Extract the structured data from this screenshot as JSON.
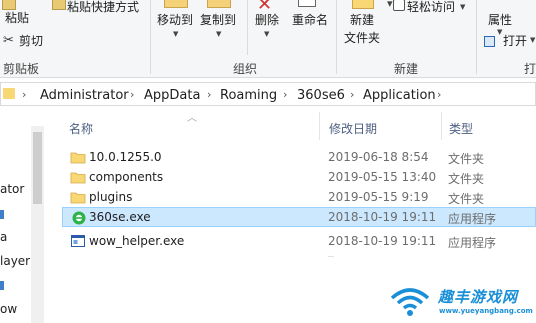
{
  "ribbon": {
    "paste_shortcut_label": "粘贴快捷方式",
    "paste_label": "粘贴",
    "cut_label": "剪切",
    "clipboard_group": "剪贴板",
    "move_to_label": "移动到",
    "copy_to_label": "复制到",
    "delete_label": "删除",
    "rename_label": "重命名",
    "organize_group": "组织",
    "new_label": "新建",
    "new_folder_label": "文件夹",
    "easy_access_label": "轻松访问",
    "new_group": "新建",
    "properties_label": "属性",
    "open_label": "打开",
    "open_group_partial": "打"
  },
  "breadcrumb": [
    "Administrator",
    "AppData",
    "Roaming",
    "360se6",
    "Application"
  ],
  "nav_pane": {
    "items": [
      "ator",
      "a",
      "layer",
      "ow"
    ]
  },
  "columns": {
    "name": "名称",
    "modified": "修改日期",
    "type": "类型"
  },
  "files": [
    {
      "name": "10.0.1255.0",
      "modified": "2019-06-18 8:54",
      "type": "文件夹",
      "icon": "folder-icon"
    },
    {
      "name": "components",
      "modified": "2019-05-15 13:40",
      "type": "文件夹",
      "icon": "folder-icon"
    },
    {
      "name": "plugins",
      "modified": "2019-05-15 9:19",
      "type": "文件夹",
      "icon": "folder-icon"
    },
    {
      "name": "360se.exe",
      "modified": "2018-10-19 19:11",
      "type": "应用程序",
      "icon": "360se-browser-icon"
    },
    {
      "name": "wow_helper.exe",
      "modified": "2018-10-19 19:11",
      "type": "应用程序",
      "icon": "application-icon"
    }
  ],
  "watermark": {
    "text": "趣丰游戏网",
    "url": "www.yueyangbang.com"
  },
  "colors": {
    "selection_bg": "#cce8ff",
    "selection_border": "#99d1ff",
    "header_text": "#4d6082",
    "folder": "#f8d775",
    "watermark": "#1a8fd8"
  }
}
